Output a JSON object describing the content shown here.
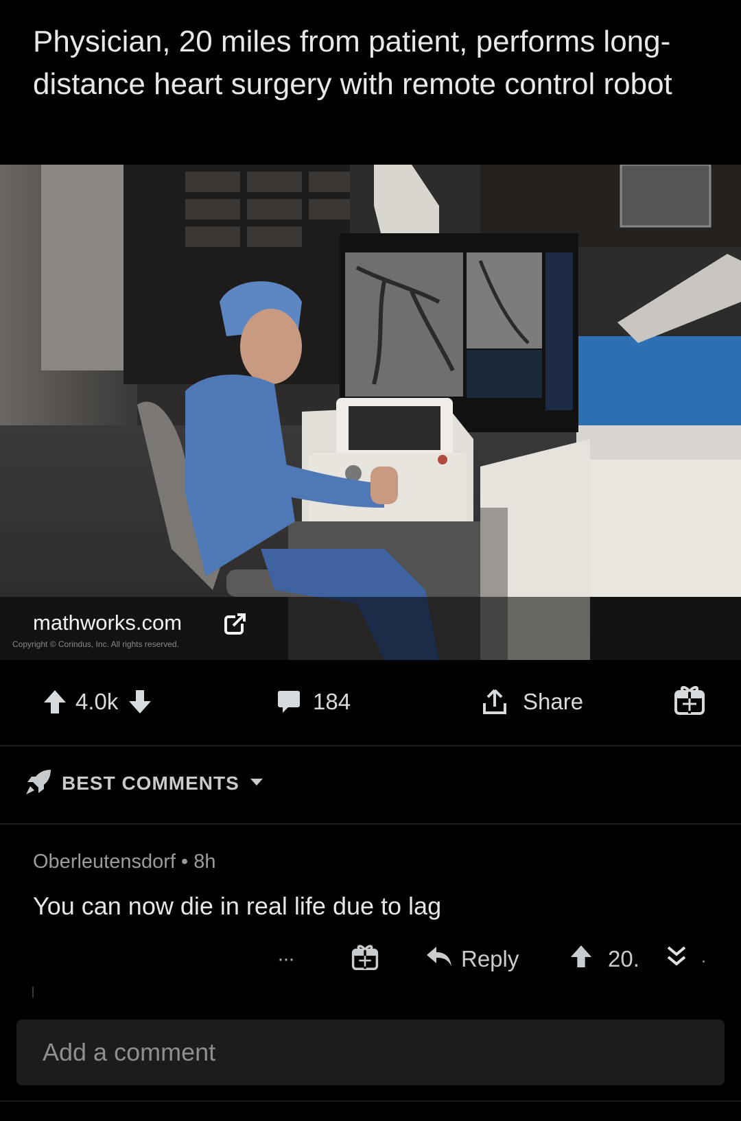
{
  "post": {
    "title": "Physician, 20 miles from patient, performs long-distance heart surgery with remote control robot"
  },
  "media": {
    "link_domain": "mathworks.com",
    "copyright": "Copyright © Corindus, Inc. All rights reserved."
  },
  "actions": {
    "score": "4.0k",
    "comment_count": "184",
    "share_label": "Share"
  },
  "sort": {
    "label": "BEST COMMENTS"
  },
  "comment": {
    "meta": "Oberleutensdorf • 8h",
    "body": "You can now die in real life due to lag",
    "more_label": "···",
    "reply_label": "Reply",
    "score": "20."
  },
  "composer": {
    "placeholder": "Add a comment"
  },
  "icons": {
    "upvote": "upvote-arrow-icon",
    "downvote": "downvote-arrow-icon",
    "comments": "comment-bubble-icon",
    "share": "share-icon",
    "award": "gift-award-icon",
    "sort": "rocket-icon",
    "reply": "reply-arrow-icon",
    "collapse": "double-chevron-icon",
    "external_link": "external-link-icon"
  },
  "colors": {
    "background": "#000000",
    "text": "#d7dadc",
    "muted": "#9a9c9e",
    "input_bg": "#1c1c1e"
  }
}
